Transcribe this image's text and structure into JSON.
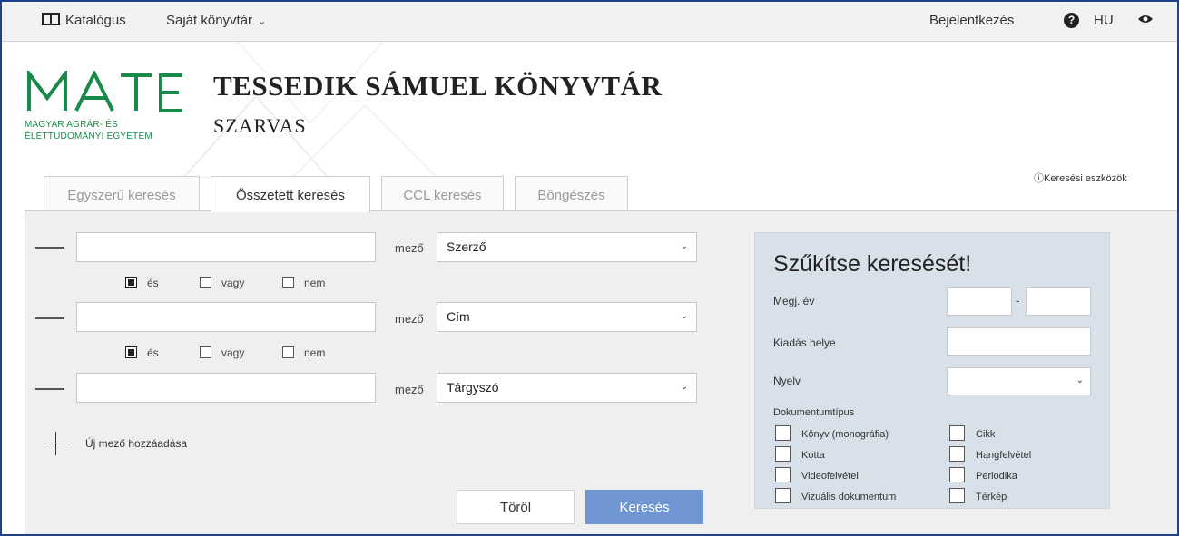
{
  "nav": {
    "catalog": "Katalógus",
    "my_library": "Saját könyvtár",
    "login": "Bejelentkezés",
    "help": "?",
    "language": "HU"
  },
  "header": {
    "logo_word": "MATE",
    "logo_line1": "MAGYAR AGRÁR- ÉS",
    "logo_line2": "ÉLETTUDOMÁNYI EGYETEM",
    "title": "TESSEDIK SÁMUEL KÖNYVTÁR",
    "subtitle": "SZARVAS",
    "tips_link": "Keresési eszközök"
  },
  "tabs": [
    "Egyszerű keresés",
    "Összetett keresés",
    "CCL keresés",
    "Böngészés"
  ],
  "search": {
    "field_label": "mező",
    "rows": [
      {
        "field": "Szerző"
      },
      {
        "field": "Cím"
      },
      {
        "field": "Tárgyszó"
      }
    ],
    "bool_and": "és",
    "bool_or": "vagy",
    "bool_not": "nem",
    "add_label": "Új mező hozzáadása",
    "clear_button": "Töröl",
    "search_button": "Keresés"
  },
  "refine": {
    "title": "Szűkítse keresését!",
    "year_label": "Megj. év",
    "year_dash": "-",
    "place_label": "Kiadás helye",
    "lang_label": "Nyelv",
    "doctype_label": "Dokumentumtípus",
    "doc_types_left": [
      "Könyv (monográfia)",
      "Kotta",
      "Videofelvétel",
      "Vizuális dokumentum"
    ],
    "doc_types_right": [
      "Cikk",
      "Hangfelvétel",
      "Periodika",
      "Térkép"
    ]
  },
  "colors": {
    "brand_green": "#1a8a4a",
    "search_button": "#6f95d2",
    "refine_bg": "#d8e1ea",
    "frame_border": "#1f3f8f"
  }
}
